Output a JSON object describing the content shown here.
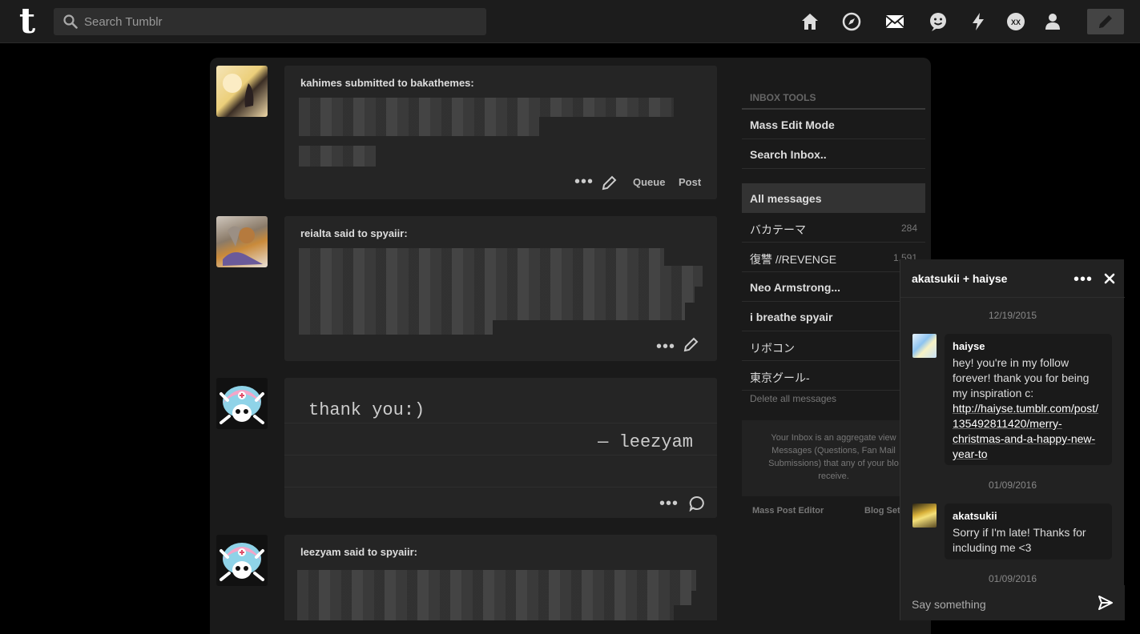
{
  "header": {
    "search_placeholder": "Search Tumblr",
    "logo": "t",
    "nav_icons": [
      "home-icon",
      "explore-icon",
      "inbox-icon",
      "messaging-icon",
      "activity-icon",
      "blog-icon",
      "account-icon"
    ],
    "compose_icon": "pencil-icon"
  },
  "posts": [
    {
      "heading": "kahimes submitted to bakathemes:",
      "actions": {
        "queue": "Queue",
        "post": "Post"
      }
    },
    {
      "heading": "reialta said to spyaiir:"
    },
    {
      "text": "thank you:)",
      "signature": "— leezyam"
    },
    {
      "heading": "leezyam said to spyaiir:"
    }
  ],
  "sidebar": {
    "tools_title": "INBOX TOOLS",
    "mass_edit": "Mass Edit Mode",
    "search_inbox": "Search Inbox..",
    "blogs": [
      {
        "label": "All messages",
        "count": ""
      },
      {
        "label": "バカテーマ",
        "count": "284"
      },
      {
        "label": "復讐 //REVENGE",
        "count": "1,591"
      },
      {
        "label": "Neo Armstrong...",
        "count": ""
      },
      {
        "label": "i breathe spyair",
        "count": ""
      },
      {
        "label": "リボコン",
        "count": ""
      },
      {
        "label": "東京グール-",
        "count": ""
      }
    ],
    "delete_all": "Delete all messages",
    "info_text": "Your Inbox is an aggregate view Messages (Questions, Fan Mail Submissions) that any of your blo receive.",
    "footer_left": "Mass Post Editor",
    "footer_right": "Blog Setti"
  },
  "chat": {
    "title": "akatsukii + haiyse",
    "messages": [
      {
        "date": "12/19/2015",
        "name": "haiyse",
        "text": "hey! you're in my follow forever! thank you for being my inspiration c:",
        "link": "http://haiyse.tumblr.com/post/135492811420/merry-christmas-and-a-happy-new-year-to"
      },
      {
        "date": "01/09/2016",
        "name": "akatsukii",
        "text": "Sorry if I'm late! Thanks for including me <3"
      }
    ],
    "last_date": "01/09/2016",
    "input_placeholder": "Say something"
  },
  "colors": {
    "background": "#000000",
    "topbar": "#1c1c1c",
    "card": "#1a1a1a",
    "post": "#252525",
    "chat": "#222222"
  }
}
